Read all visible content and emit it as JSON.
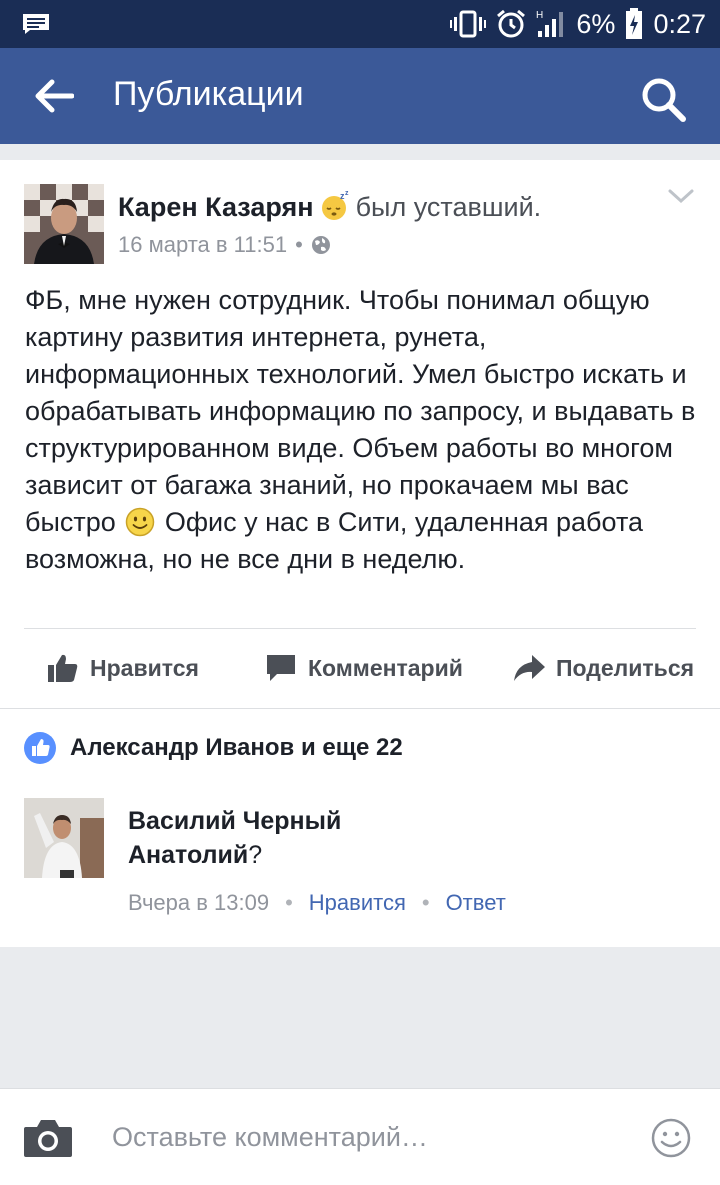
{
  "status_bar": {
    "battery_percent": "6%",
    "time": "0:27",
    "signal_label": "H",
    "icons": [
      "message-icon",
      "vibrate-icon",
      "alarm-icon",
      "signal-icon",
      "battery-charging-icon"
    ]
  },
  "app_bar": {
    "title": "Публикации",
    "icons": [
      "back-arrow-icon",
      "search-icon"
    ]
  },
  "post": {
    "author": "Карен Казарян",
    "feeling": "был уставший.",
    "feeling_icon": "sleeping-emoji-icon",
    "date": "16 марта в 11:51",
    "separator": "•",
    "privacy_icon": "globe-icon",
    "text_part1": "ФБ, мне нужен сотрудник. Чтобы понимал общую картину развития интернета, рунета, информационных технологий. Умел быстро искать и обрабатывать информацию по запросу, и выдавать в структурированном виде. Объем работы во многом зависит от багажа знаний, но прокачаем мы вас быстро",
    "text_part2": "Офис у нас в Сити, удаленная работа возможна, но не все дни в неделю."
  },
  "actions": {
    "like": "Нравится",
    "comment": "Комментарий",
    "share": "Поделиться"
  },
  "likes_summary": "Александр Иванов и еще 22",
  "comment": {
    "author": "Василий Черный",
    "text": "Анатолий",
    "punct": "?",
    "time": "Вчера в 13:09",
    "like": "Нравится",
    "reply": "Ответ",
    "separator": "•"
  },
  "composer": {
    "placeholder": "Оставьте комментарий…"
  },
  "colors": {
    "status_bar": "#1a2d55",
    "app_bar": "#3b5998",
    "link": "#4267b2",
    "like_badge": "#5890ff"
  }
}
